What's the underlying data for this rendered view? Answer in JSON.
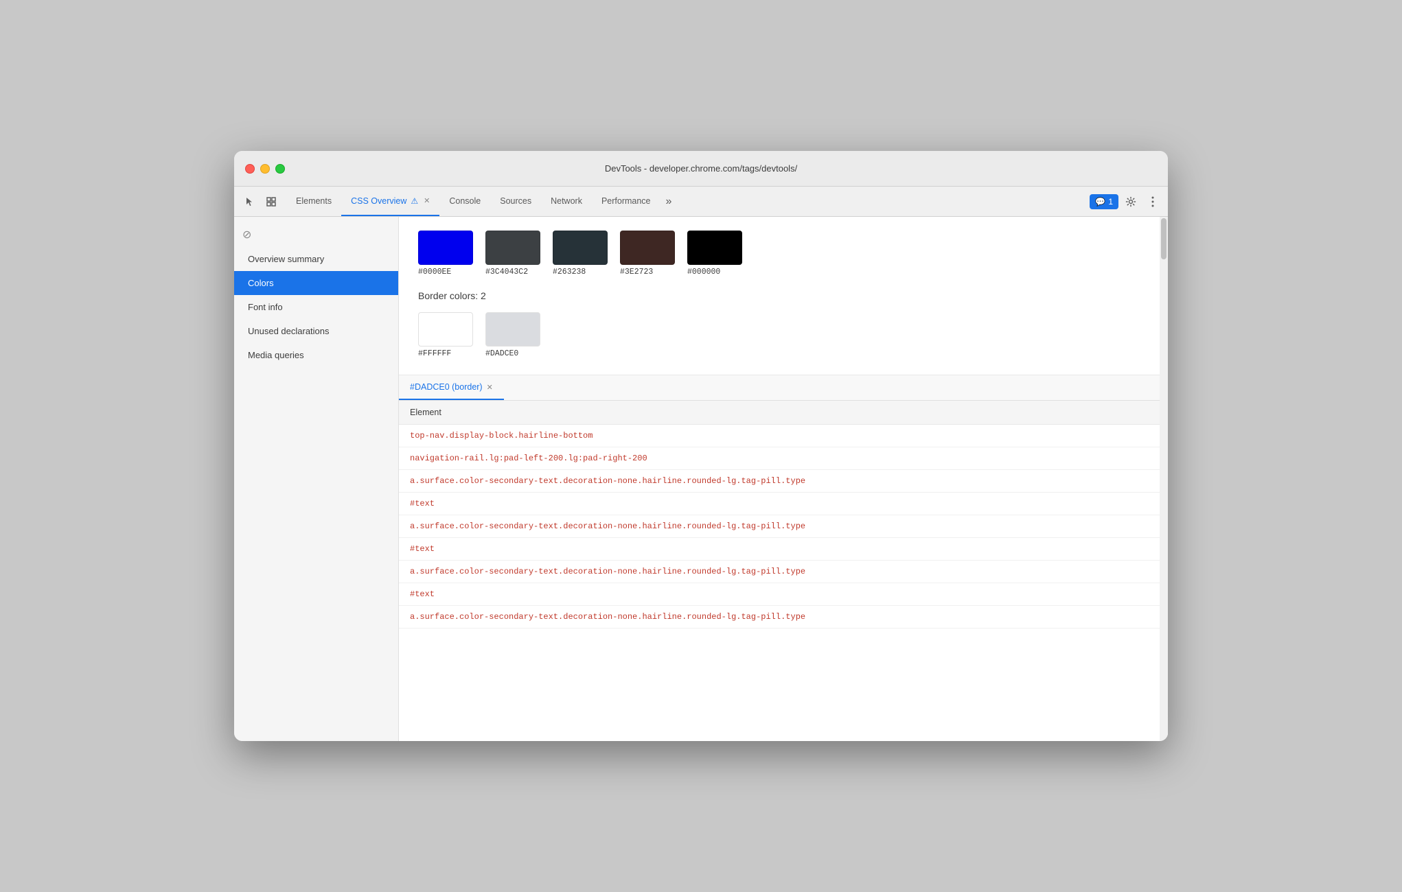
{
  "window": {
    "title": "DevTools - developer.chrome.com/tags/devtools/"
  },
  "tabs": [
    {
      "id": "elements",
      "label": "Elements",
      "active": false
    },
    {
      "id": "css-overview",
      "label": "CSS Overview",
      "active": true,
      "warning": "⚠",
      "closeable": true
    },
    {
      "id": "console",
      "label": "Console",
      "active": false
    },
    {
      "id": "sources",
      "label": "Sources",
      "active": false
    },
    {
      "id": "network",
      "label": "Network",
      "active": false
    },
    {
      "id": "performance",
      "label": "Performance",
      "active": false
    }
  ],
  "toolbar": {
    "more_tabs_label": "»",
    "badge_count": "1",
    "badge_icon": "💬"
  },
  "sidebar": {
    "items": [
      {
        "id": "overview-summary",
        "label": "Overview summary",
        "active": false
      },
      {
        "id": "colors",
        "label": "Colors",
        "active": true
      },
      {
        "id": "font-info",
        "label": "Font info",
        "active": false
      },
      {
        "id": "unused-declarations",
        "label": "Unused declarations",
        "active": false
      },
      {
        "id": "media-queries",
        "label": "Media queries",
        "active": false
      }
    ]
  },
  "colors_section": {
    "top_swatches": [
      {
        "hex": "#0000EE",
        "color": "#0000EE"
      },
      {
        "hex": "#3C4043C2",
        "color": "#3C4043"
      },
      {
        "hex": "#263238",
        "color": "#263238"
      },
      {
        "hex": "#3E2723",
        "color": "#3E2723"
      },
      {
        "hex": "#000000",
        "color": "#000000"
      }
    ],
    "border_heading": "Border colors: 2",
    "border_swatches": [
      {
        "hex": "#FFFFFF",
        "color": "#FFFFFF"
      },
      {
        "hex": "#DADCE0",
        "color": "#DADCE0"
      }
    ]
  },
  "element_panel": {
    "active_tab_label": "#DADCE0 (border)",
    "column_header": "Element",
    "rows": [
      {
        "text": "top-nav.display-block.hairline-bottom",
        "type": "selector"
      },
      {
        "text": "navigation-rail.lg:pad-left-200.lg:pad-right-200",
        "type": "selector"
      },
      {
        "text": "a.surface.color-secondary-text.decoration-none.hairline.rounded-lg.tag-pill.type",
        "type": "selector"
      },
      {
        "text": "#text",
        "type": "text-node"
      },
      {
        "text": "a.surface.color-secondary-text.decoration-none.hairline.rounded-lg.tag-pill.type",
        "type": "selector"
      },
      {
        "text": "#text",
        "type": "text-node"
      },
      {
        "text": "a.surface.color-secondary-text.decoration-none.hairline.rounded-lg.tag-pill.type",
        "type": "selector"
      },
      {
        "text": "#text",
        "type": "text-node"
      },
      {
        "text": "a.surface.color-secondary-text.decoration-none.hairline.rounded-lg.tag-pill.type",
        "type": "selector"
      }
    ]
  }
}
